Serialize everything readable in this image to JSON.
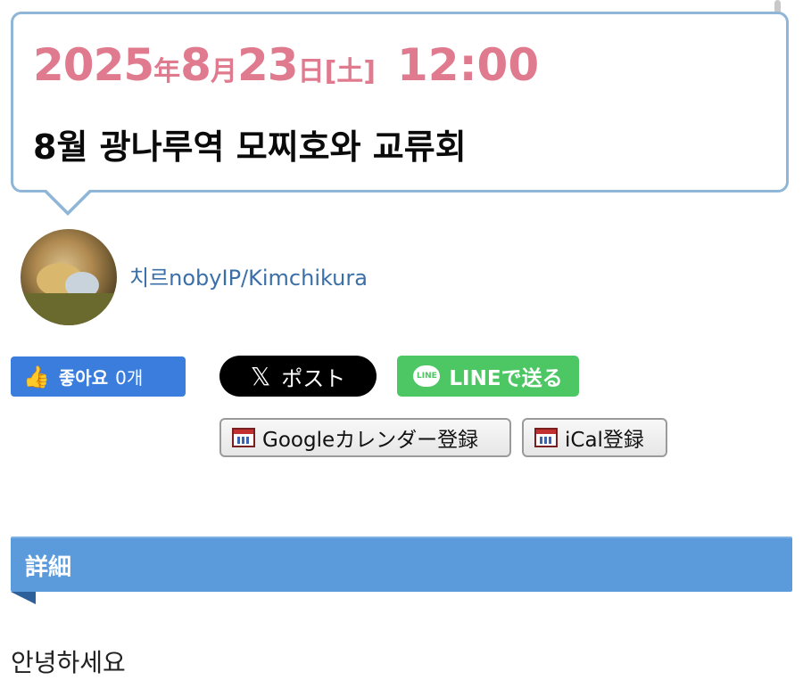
{
  "event": {
    "date": {
      "year": "2025",
      "year_unit": "年",
      "month": "8",
      "month_unit": "月",
      "day": "23",
      "day_unit": "日",
      "weekday": "[土]",
      "time": "12:00"
    },
    "title": "8월 광나루역 모찌호와 교류회"
  },
  "author": {
    "name": "치르nobyIP/Kimchikura"
  },
  "share": {
    "like_label": "좋아요",
    "like_count": "0개",
    "post_x_glyph": "𝕏",
    "post_label": "ポスト",
    "line_icon_text": "LINE",
    "line_label": "LINEで送る"
  },
  "calendar": {
    "google_label": "Googleカレンダー登録",
    "ical_label": "iCal登録"
  },
  "section": {
    "heading": "詳細"
  },
  "content": {
    "first_line": "안녕하세요"
  },
  "colors": {
    "accent_pink": "#e07a8e",
    "bubble_border": "#8fb6d6",
    "link_blue": "#3a6fa8",
    "like_blue": "#3b7ddd",
    "line_green": "#4cc764",
    "section_blue": "#5b9bdb"
  }
}
